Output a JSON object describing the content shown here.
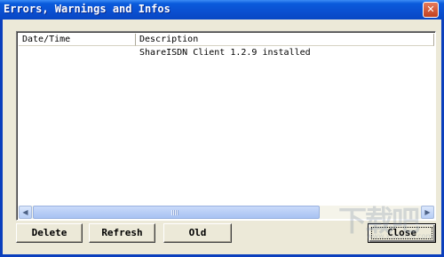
{
  "window": {
    "title": "Errors, Warnings and Infos",
    "close_glyph": "✕"
  },
  "listview": {
    "columns": [
      "Date/Time",
      "Description"
    ],
    "rows": [
      {
        "datetime": "",
        "description": "ShareISDN Client 1.2.9 installed"
      }
    ]
  },
  "scrollbar": {
    "left_arrow": "◀",
    "right_arrow": "▶"
  },
  "buttons": {
    "delete": "Delete",
    "refresh": "Refresh",
    "old": "Old",
    "close": "Close"
  },
  "watermark": {
    "logo": "下载吧",
    "site": "www.xiazaiba.com"
  },
  "colors": {
    "titlebar": "#0a4fd0",
    "face": "#ece9d8",
    "scrollbar": "#b7cdf5"
  },
  "icons": [
    "close-icon",
    "scroll-left-icon",
    "scroll-right-icon",
    "grip-icon"
  ]
}
